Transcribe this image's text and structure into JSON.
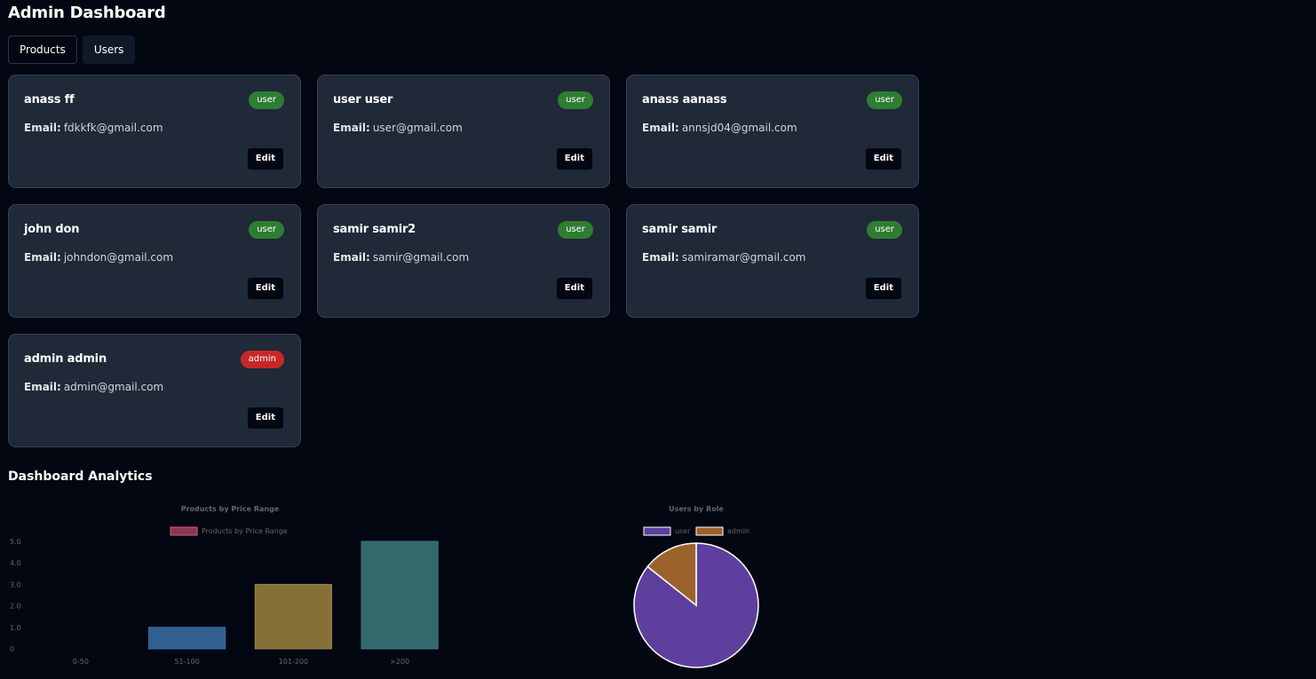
{
  "page": {
    "title": "Admin Dashboard",
    "tabs": [
      {
        "label": "Products"
      },
      {
        "label": "Users"
      }
    ]
  },
  "users": [
    {
      "name": "anass ff",
      "role": "user",
      "email_label": "Email:",
      "email": "fdkkfk@gmail.com",
      "edit_label": "Edit"
    },
    {
      "name": "user user",
      "role": "user",
      "email_label": "Email:",
      "email": "user@gmail.com",
      "edit_label": "Edit"
    },
    {
      "name": "anass aanass",
      "role": "user",
      "email_label": "Email:",
      "email": "annsjd04@gmail.com",
      "edit_label": "Edit"
    },
    {
      "name": "john don",
      "role": "user",
      "email_label": "Email:",
      "email": "johndon@gmail.com",
      "edit_label": "Edit"
    },
    {
      "name": "samir samir2",
      "role": "user",
      "email_label": "Email:",
      "email": "samir@gmail.com",
      "edit_label": "Edit"
    },
    {
      "name": "samir samir",
      "role": "user",
      "email_label": "Email:",
      "email": "samiramar@gmail.com",
      "edit_label": "Edit"
    },
    {
      "name": "admin admin",
      "role": "admin",
      "email_label": "Email:",
      "email": "admin@gmail.com",
      "edit_label": "Edit"
    }
  ],
  "colors": {
    "user_badge": "#2f7d32",
    "admin_badge": "#c62828",
    "card_bg": "#1f2937",
    "page_bg": "#030712"
  },
  "analytics": {
    "title": "Dashboard Analytics"
  },
  "chart_data": [
    {
      "type": "bar",
      "title": "Products by Price Range",
      "categories": [
        "0-50",
        "51-100",
        "101-200",
        ">200"
      ],
      "series": [
        {
          "name": "Products by Price Range",
          "values": [
            0,
            1,
            3,
            5
          ]
        }
      ],
      "bar_colors": [
        "#e05a7a",
        "#3a6ea5",
        "#9c8240",
        "#3a7a7e"
      ],
      "yticks": [
        "0",
        "1.0",
        "2.0",
        "3.0",
        "4.0",
        "5.0"
      ],
      "ylim": [
        0,
        5
      ],
      "legend_position": "top",
      "grid": false
    },
    {
      "type": "pie",
      "title": "Users by Role",
      "categories": [
        "user",
        "admin"
      ],
      "values": [
        6,
        1
      ],
      "colors": [
        "#5e3f9e",
        "#9c622b"
      ],
      "legend_position": "top"
    }
  ]
}
